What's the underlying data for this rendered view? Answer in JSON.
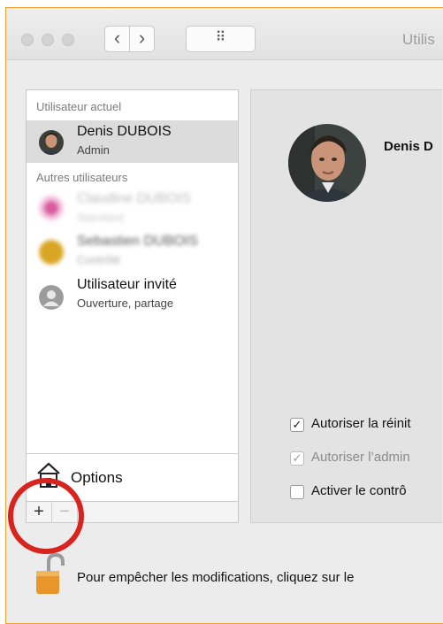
{
  "window": {
    "title": "Utilis"
  },
  "toolbar": {
    "back_glyph": "‹",
    "forward_glyph": "›",
    "grid_glyph": "⠿"
  },
  "user_list": {
    "current_header": "Utilisateur actuel",
    "current_user": {
      "name": "Denis DUBOIS",
      "role": "Admin"
    },
    "others_header": "Autres utilisateurs",
    "others": [
      {
        "name": "Claudine DUBOIS",
        "role": "Standard",
        "avatar_color": "#d85aa0"
      },
      {
        "name": "Sebastien DUBOIS",
        "role": "Contrôlé",
        "avatar_color": "#d9a623"
      },
      {
        "name": "Utilisateur invité",
        "role": "Ouverture, partage",
        "avatar_color": "#9c9c9c"
      }
    ],
    "options_label": "Options",
    "add_label": "+",
    "remove_label": "−"
  },
  "detail": {
    "full_name": "Denis D",
    "checkboxes": [
      {
        "label": "Autoriser la réinit",
        "checked": true,
        "enabled": true
      },
      {
        "label": "Autoriser l’admin",
        "checked": true,
        "enabled": false
      },
      {
        "label": "Activer le contrô",
        "checked": false,
        "enabled": true
      }
    ]
  },
  "footer": {
    "lock_text": "Pour empêcher les modifications, cliquez sur le"
  },
  "colors": {
    "window_border": "#f0a030",
    "highlight_circle": "#d7241f",
    "selection": "#dcdcdc"
  }
}
